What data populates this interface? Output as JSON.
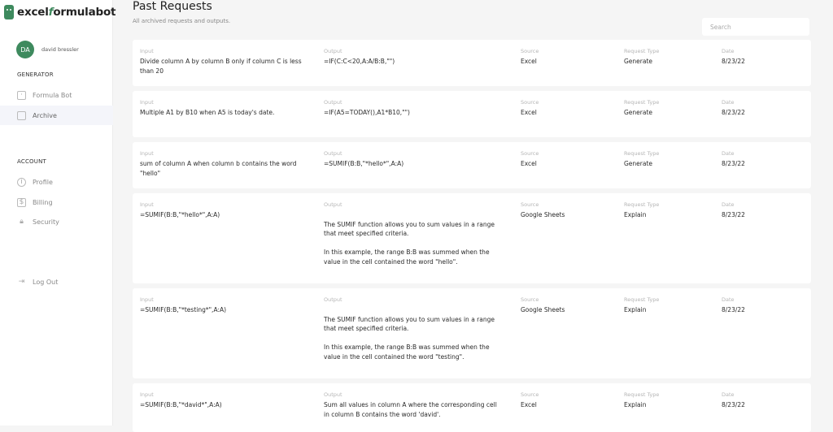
{
  "app": {
    "logo_prefix": "excel",
    "logo_mid": "f",
    "logo_suffix": "ormulabot"
  },
  "user": {
    "initials": "DA",
    "name": "david bressler"
  },
  "sidebar": {
    "generator_heading": "GENERATOR",
    "generator_items": [
      {
        "label": "Formula Bot",
        "icon": "bot-icon"
      },
      {
        "label": "Archive",
        "icon": "archive-icon",
        "active": true
      }
    ],
    "account_heading": "ACCOUNT",
    "account_items": [
      {
        "label": "Profile",
        "icon": "info-icon"
      },
      {
        "label": "Billing",
        "icon": "dollar-icon"
      },
      {
        "label": "Security",
        "icon": "lock-icon"
      }
    ],
    "logout": "Log Out"
  },
  "page": {
    "title": "Past Requests",
    "subtitle": "All archived requests and outputs.",
    "search_placeholder": "Search"
  },
  "columns": {
    "input": "Input",
    "output": "Output",
    "source": "Source",
    "type": "Request Type",
    "date": "Date"
  },
  "requests": [
    {
      "input": "Divide column A by column B only if column C is less than 20",
      "output": "=IF(C:C<20,A:A/B:B,\"\")",
      "source": "Excel",
      "type": "Generate",
      "date": "8/23/22"
    },
    {
      "input": "Multiple A1 by B10 when A5 is today's date.",
      "output": "=IF(A5=TODAY(),A1*B10,\"\")",
      "source": "Excel",
      "type": "Generate",
      "date": "8/23/22"
    },
    {
      "input": "sum of column A when column b contains the word \"hello\"",
      "output": "=SUMIF(B:B,\"*hello*\",A:A)",
      "source": "Excel",
      "type": "Generate",
      "date": "8/23/22"
    },
    {
      "input": "=SUMIF(B:B,\"*hello*\",A:A)",
      "output": "\nThe SUMIF function allows you to sum values in a range that meet specified criteria.\n\nIn this example, the range B:B was summed when the value in the cell contained the word \"hello\".",
      "source": "Google Sheets",
      "type": "Explain",
      "date": "8/23/22"
    },
    {
      "input": "=SUMIF(B:B,\"*testing*\",A:A)",
      "output": "\nThe SUMIF function allows you to sum values in a range that meet specified criteria.\n\nIn this example, the range B:B was summed when the value in the cell contained the word \"testing\".",
      "source": "Google Sheets",
      "type": "Explain",
      "date": "8/23/22"
    },
    {
      "input": "=SUMIF(B:B,\"*david*\",A:A)",
      "output": "Sum all values in column A where the corresponding cell in column B contains the word 'david'.",
      "source": "Excel",
      "type": "Explain",
      "date": "8/23/22"
    }
  ]
}
